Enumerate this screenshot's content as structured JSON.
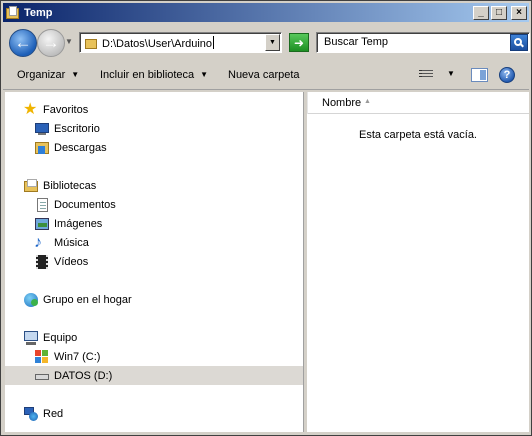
{
  "window": {
    "title": "Temp",
    "controls": [
      "minimize",
      "maximize",
      "close"
    ]
  },
  "address_bar": {
    "path": "D:\\Datos\\User\\Arduino",
    "search_placeholder": "Buscar Temp"
  },
  "command_bar": {
    "organize": "Organizar",
    "include_in_library": "Incluir en biblioteca",
    "new_folder": "Nueva carpeta"
  },
  "nav_pane": {
    "favorites": {
      "label": "Favoritos",
      "items": [
        {
          "label": "Escritorio",
          "icon": "desktop-icon"
        },
        {
          "label": "Descargas",
          "icon": "downloads-icon"
        }
      ]
    },
    "libraries": {
      "label": "Bibliotecas",
      "items": [
        {
          "label": "Documentos",
          "icon": "documents-icon"
        },
        {
          "label": "Imágenes",
          "icon": "pictures-icon"
        },
        {
          "label": "Música",
          "icon": "music-icon"
        },
        {
          "label": "Vídeos",
          "icon": "videos-icon"
        }
      ]
    },
    "homegroup": {
      "label": "Grupo en el hogar"
    },
    "computer": {
      "label": "Equipo",
      "items": [
        {
          "label": "Win7 (C:)",
          "icon": "windows-drive-icon"
        },
        {
          "label": "DATOS (D:)",
          "icon": "drive-icon",
          "selected": true
        }
      ]
    },
    "network": {
      "label": "Red"
    }
  },
  "content": {
    "column_name": "Nombre",
    "empty_message": "Esta carpeta está vacía."
  },
  "colors": {
    "titlebar_start": "#0a246a",
    "titlebar_end": "#a6caf0",
    "chrome": "#d4d0c8",
    "selection": "#dcd9d4"
  }
}
